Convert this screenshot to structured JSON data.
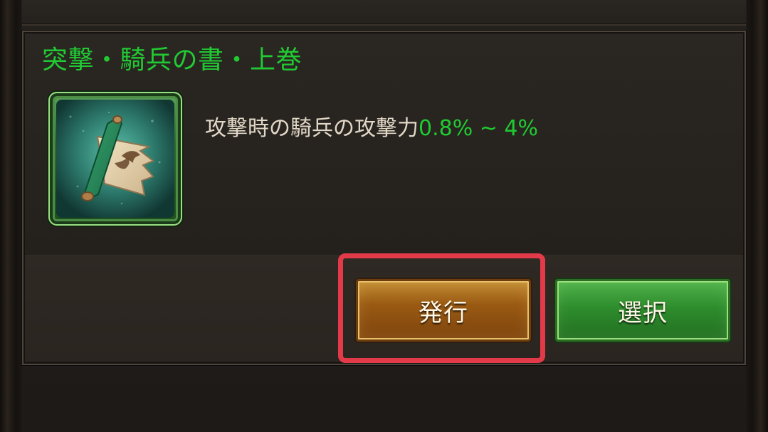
{
  "item": {
    "title": "突撃・騎兵の書・上巻",
    "description": {
      "text": "攻撃時の騎兵の攻撃力",
      "value": "0.8% ~ 4%"
    },
    "icon": "scroll-horse-icon"
  },
  "buttons": {
    "issue_label": "発行",
    "select_label": "選択"
  },
  "colors": {
    "title_green": "#21ca33",
    "value_green": "#1fca31",
    "description_text": "#e2d8c7",
    "issue_button": "#9a5a13",
    "select_button": "#2e8d2d",
    "highlight_red": "#e33a4a"
  }
}
